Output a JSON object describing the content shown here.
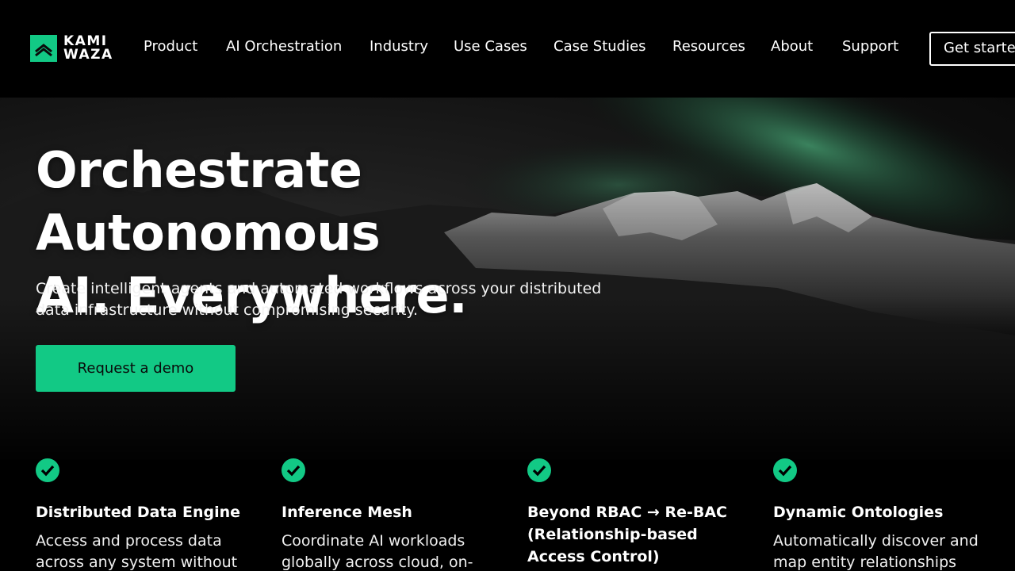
{
  "nav": {
    "logo_line1": "KAMI",
    "logo_line2": "WAZA",
    "items": [
      {
        "label": "Product"
      },
      {
        "label": "AI Orchestration"
      },
      {
        "label": "Industry"
      },
      {
        "label": "Use Cases"
      },
      {
        "label": "Case Studies"
      },
      {
        "label": "Resources"
      },
      {
        "label": "About"
      },
      {
        "label": "Support"
      }
    ],
    "cta_label": "Get started"
  },
  "hero": {
    "title_line1": "Orchestrate Autonomous",
    "title_line2": "AI. Everywhere.",
    "subtitle": "Create intelligent agents and automated workflows across your distributed data infrastructure without compromising security.",
    "demo_button": "Request a demo"
  },
  "features": [
    {
      "icon": "check-circle-icon",
      "title": "Distributed Data Engine",
      "desc": "Access and process data across any system without"
    },
    {
      "icon": "check-circle-icon",
      "title": "Inference Mesh",
      "desc": "Coordinate AI workloads globally across cloud, on-"
    },
    {
      "icon": "check-circle-icon",
      "title": "Beyond RBAC → Re-BAC (Relationship-based Access Control)",
      "desc": ""
    },
    {
      "icon": "check-circle-icon",
      "title": "Dynamic Ontologies",
      "desc": "Automatically discover and map entity relationships"
    }
  ],
  "colors": {
    "accent": "#12c985",
    "background": "#000000",
    "text": "#ffffff"
  }
}
